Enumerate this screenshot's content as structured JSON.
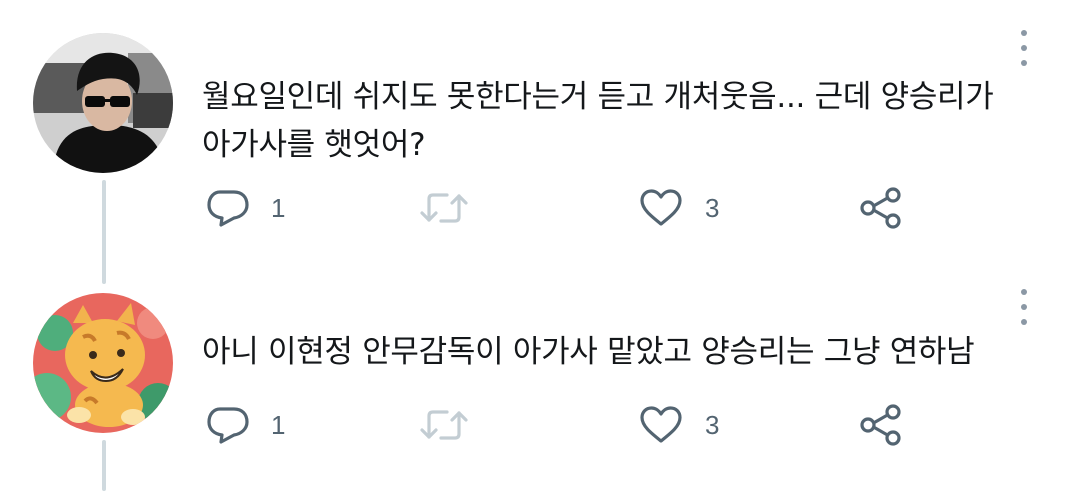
{
  "replies": [
    {
      "text": "월요일인데 쉬지도 못한다는거 듣고 개처웃음... 근데 양승리가\n아가사를 햇엇어?",
      "reply_count": "1",
      "like_count": "3"
    },
    {
      "text": "아니 이현정 안무감독이 아가사 맡았고 양승리는 그냥 연하남",
      "reply_count": "1",
      "like_count": "3"
    }
  ],
  "icons": {
    "reply": "speech-bubble-icon",
    "retweet": "retweet-arrows-icon",
    "like": "heart-outline-icon",
    "share": "share-nodes-icon",
    "more": "vertical-ellipsis-icon"
  },
  "colors": {
    "text": "#14171a",
    "icon": "#536471",
    "retweet_icon": "#c3cdd3",
    "thread_line": "#cfd9de"
  }
}
